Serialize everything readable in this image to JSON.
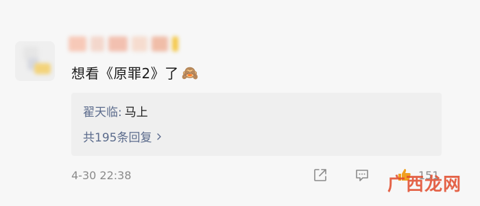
{
  "comment": {
    "text": "想看《原罪2》了",
    "emoji": "🙈",
    "timestamp": "4-30 22:38"
  },
  "reply_preview": {
    "author": "翟天临:",
    "content": "马上",
    "count_label": "共195条回复"
  },
  "actions": {
    "like_count": "151"
  },
  "watermark": "广西龙网",
  "colors": {
    "background": "#f7f7f7",
    "reply_box": "#efefef",
    "link_blue": "#5b6b8c",
    "meta_gray": "#8a8a8a",
    "like_orange": "#f0a020"
  },
  "icons": {
    "share": "share-icon",
    "comment": "comment-icon",
    "like": "thumbs-up-icon",
    "chevron": "chevron-right-icon"
  }
}
